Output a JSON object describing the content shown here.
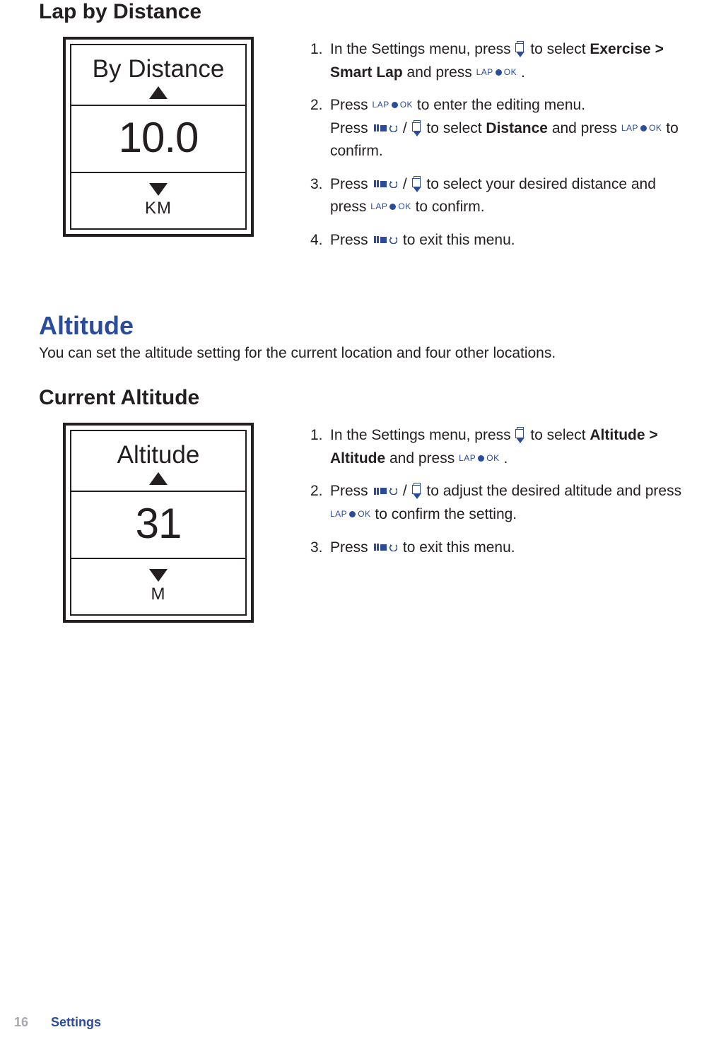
{
  "sections": {
    "lap_by_distance": {
      "heading": "Lap by Distance",
      "device": {
        "title": "By Distance",
        "value": "10.0",
        "unit": "KM"
      },
      "steps": [
        {
          "n": "1.",
          "pre": "In the Settings menu, press ",
          "icon1": "page-down",
          "mid1": " to select ",
          "bold1": "Exercise > Smart Lap",
          "mid2": " and press ",
          "icon2": "lap-ok",
          "tail": " ."
        },
        {
          "n": "2.",
          "pre": "Press ",
          "icon1": "lap-ok",
          "mid1": " to enter the editing menu.",
          "line2_pre": "Press ",
          "line2_iconA": "back",
          "line2_slash": " / ",
          "line2_iconB": "page-down",
          "line2_mid": " to  select ",
          "line2_bold": "Distance",
          "line2_mid2": " and press ",
          "line2_iconC": "lap-ok",
          "line2_tail": " to confirm."
        },
        {
          "n": "3.",
          "pre": "Press ",
          "iconA": "back",
          "slash": " / ",
          "iconB": "page-down",
          "mid1": " to select your desired distance and press ",
          "iconC": "lap-ok",
          "tail": " to confirm."
        },
        {
          "n": "4.",
          "pre": "Press ",
          "icon1": "back",
          "tail": " to exit this menu."
        }
      ]
    },
    "altitude": {
      "heading": "Altitude",
      "intro": "You can set the altitude setting for the current location and four other locations.",
      "sub_heading": "Current Altitude",
      "device": {
        "title": "Altitude",
        "value": "31",
        "unit": "M"
      },
      "steps": [
        {
          "n": "1.",
          "pre": "In the Settings menu, press ",
          "icon1": "page-down",
          "mid1": " to select ",
          "bold1": "Altitude > Altitude",
          "mid2": " and press ",
          "icon2": "lap-ok",
          "tail": "  ."
        },
        {
          "n": "2.",
          "pre": "Press ",
          "iconA": "back",
          "slash": " / ",
          "iconB": "page-down",
          "mid1": " to adjust the desired altitude and press ",
          "iconC": "lap-ok",
          "tail": " to confirm the setting."
        },
        {
          "n": "3.",
          "pre": "Press ",
          "icon1": "back",
          "tail": " to exit this menu."
        }
      ]
    }
  },
  "icons": {
    "lap_label": "LAP",
    "ok_label": "OK"
  },
  "footer": {
    "page": "16",
    "chapter": "Settings"
  }
}
